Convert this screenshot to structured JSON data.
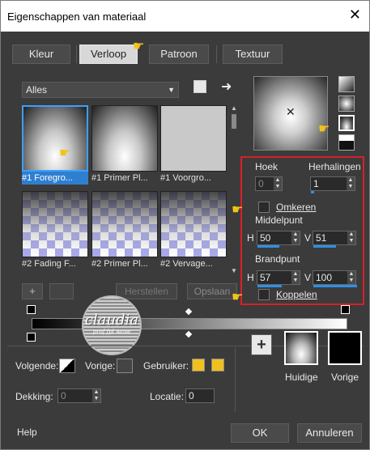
{
  "window": {
    "title": "Eigenschappen van materiaal",
    "close_glyph": "✕"
  },
  "tabs": [
    {
      "label": "Kleur",
      "active": false
    },
    {
      "label": "Verloop",
      "active": true
    },
    {
      "label": "Patroon",
      "active": false
    },
    {
      "label": "Textuur",
      "active": false
    }
  ],
  "library": {
    "category": "Alles",
    "thumbnails": [
      {
        "label": "#1 Foregro...",
        "selected": true,
        "style": "sphere"
      },
      {
        "label": "#1 Primer Pl...",
        "selected": false,
        "style": "sphere"
      },
      {
        "label": "#1 Voorgro...",
        "selected": false,
        "style": "flat"
      },
      {
        "label": "#2 Fading F...",
        "selected": false,
        "style": "checker"
      },
      {
        "label": "#2 Primer Pl...",
        "selected": false,
        "style": "checker"
      },
      {
        "label": "#2 Vervage...",
        "selected": false,
        "style": "checker"
      }
    ],
    "add_label": "+",
    "save_label": "Opslaan",
    "restore_label": "Herstellen"
  },
  "preview": {
    "center_glyph": "✕"
  },
  "settings": {
    "angle_label": "Hoek",
    "angle_value": "0",
    "repeats_label": "Herhalingen",
    "repeats_value": "1",
    "invert_label": "Omkeren",
    "invert_checked": false,
    "center_label": "Middelpunt",
    "center_h_label": "H",
    "center_h_value": "50",
    "center_v_label": "V",
    "center_v_value": "51",
    "focal_label": "Brandpunt",
    "focal_h_label": "H",
    "focal_h_value": "57",
    "focal_v_label": "V",
    "focal_v_value": "100",
    "link_label": "Koppelen",
    "link_checked": false
  },
  "watermark": {
    "name": "claudia",
    "sub": "prof fpl wave"
  },
  "bottom": {
    "next_label": "Volgende:",
    "previous_label": "Vorige:",
    "user_label": "Gebruiker:",
    "opacity_label": "Dekking:",
    "opacity_value": "0",
    "location_label": "Locatie:",
    "location_value": "0",
    "current_label": "Huidige",
    "prev_swatch_label": "Vorige",
    "add_glyph": "+"
  },
  "footer": {
    "help_label": "Help",
    "ok_label": "OK",
    "cancel_label": "Annuleren"
  },
  "colors": {
    "accent": "#2e8fe8",
    "highlight": "#d8202a",
    "user_swatch": "#f0c020",
    "panel": "#3b3b3b"
  }
}
